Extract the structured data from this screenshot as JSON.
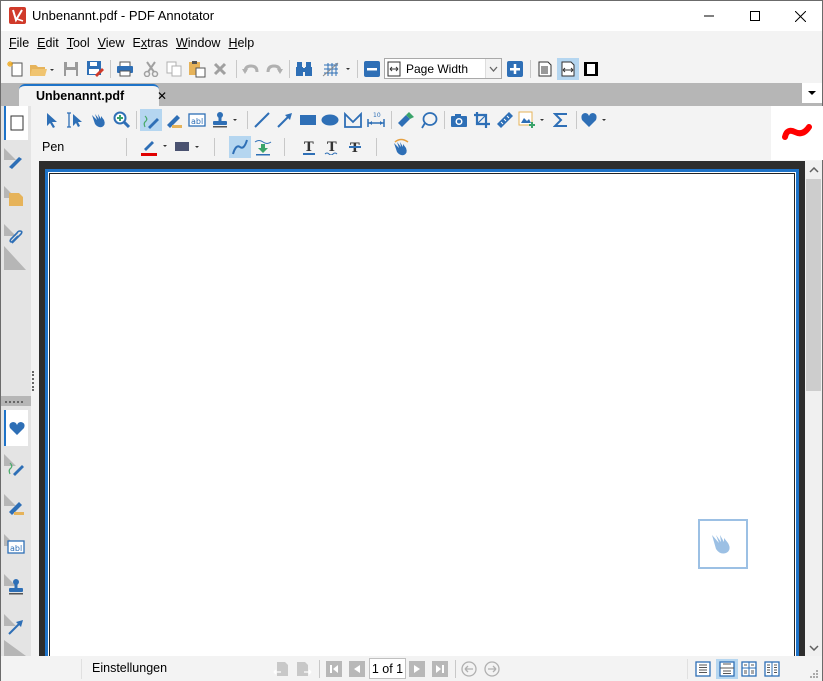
{
  "window": {
    "title": "Unbenannt.pdf - PDF Annotator",
    "controls": [
      "minimize",
      "maximize",
      "close"
    ]
  },
  "menu": {
    "items": [
      {
        "label": "File",
        "accel": "F",
        "rest": "ile"
      },
      {
        "label": "Edit",
        "accel": "E",
        "rest": "dit"
      },
      {
        "label": "Tool",
        "accel": "T",
        "rest": "ool"
      },
      {
        "label": "View",
        "accel": "V",
        "rest": "iew"
      },
      {
        "label": "Extras",
        "pre": "E",
        "accel": "x",
        "rest": "tras"
      },
      {
        "label": "Window",
        "accel": "W",
        "rest": "indow"
      },
      {
        "label": "Help",
        "accel": "H",
        "rest": "elp"
      }
    ]
  },
  "toolbar": {
    "buttons": [
      "new-document",
      "open-folder",
      "save",
      "save-as-annotated",
      "print",
      "cut",
      "copy",
      "paste",
      "delete",
      "undo",
      "redo",
      "find",
      "grid"
    ],
    "zoom": {
      "value": "Page Width",
      "zoom_out": "zoom-out",
      "zoom_in": "zoom-in"
    },
    "view_modes": [
      "full-page",
      "page-width",
      "full-screen"
    ],
    "active_view_mode": "page-width"
  },
  "tabs": {
    "items": [
      {
        "label": "Unbenannt.pdf",
        "close": "✕",
        "active": true
      }
    ]
  },
  "tools": {
    "row1": [
      "select",
      "text-select",
      "hand",
      "zoom",
      "pen",
      "highlighter",
      "text-box",
      "stamp",
      "line",
      "arrow",
      "rectangle",
      "ellipse",
      "polyline",
      "measure",
      "eraser",
      "lasso",
      "snapshot",
      "crop",
      "ruler",
      "insert-image",
      "sum",
      "favorites"
    ],
    "active_tool": "pen",
    "row2": {
      "label": "Pen",
      "pen_color": "#e00000",
      "fill_color": "#4a5270",
      "smooth_active": true
    }
  },
  "preview": {
    "stroke_color": "#ff0000"
  },
  "sidebar": {
    "top_tabs": [
      "page-thumbnails",
      "bookmarks",
      "notes",
      "attachments"
    ],
    "bottom_tabs": [
      "favorites",
      "pen",
      "highlighter",
      "text-box",
      "stamp",
      "arrow"
    ]
  },
  "status": {
    "text": "Einstellungen",
    "page": "1 of 1",
    "layout_modes": [
      "single-page",
      "continuous",
      "two-page",
      "two-page-continuous"
    ],
    "active_layout": "continuous"
  },
  "colors": {
    "accent": "#1e73c8",
    "icon_blue": "#2e6fb6",
    "active_bg": "#b5d6f0",
    "viewport_bg": "#2d2d2d"
  }
}
